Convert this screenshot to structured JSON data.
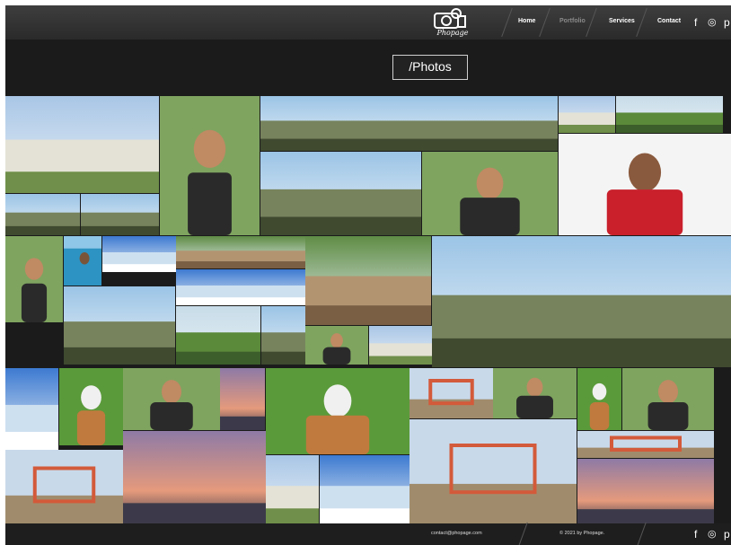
{
  "header": {
    "logo_text": "Phopage",
    "nav": [
      "Home",
      "Portfolio",
      "Services",
      "Contact"
    ]
  },
  "social": {
    "icons": [
      "facebook-icon",
      "instagram-icon",
      "pinterest-icon"
    ],
    "glyphs": [
      "f",
      "◎",
      "p"
    ]
  },
  "page_title": "/Photos",
  "footer": {
    "email": "contact@phopage.com",
    "copyright": "© 2021 by Phopage."
  },
  "photos": [
    {
      "name": "photo-apartment-complex",
      "scene": "building"
    },
    {
      "name": "photo-boxer-man",
      "scene": "portrait"
    },
    {
      "name": "photo-aerial-highway-panorama",
      "scene": "aerial"
    },
    {
      "name": "photo-apartment-building-small",
      "scene": "building"
    },
    {
      "name": "photo-aerial-curved-road",
      "scene": "aerial-green"
    },
    {
      "name": "photo-aerial-intersection",
      "scene": "aerial"
    },
    {
      "name": "photo-man-sunglasses-field",
      "scene": "portrait"
    },
    {
      "name": "photo-girl-glasses",
      "scene": "girl"
    },
    {
      "name": "photo-aerial-lake-left",
      "scene": "aerial"
    },
    {
      "name": "photo-aerial-city-small",
      "scene": "aerial"
    },
    {
      "name": "photo-man-basketball-sitting",
      "scene": "portrait"
    },
    {
      "name": "photo-man-pool-edge",
      "scene": "pool"
    },
    {
      "name": "photo-blue-sky-clouds",
      "scene": "sky"
    },
    {
      "name": "photo-boardwalk-tropical",
      "scene": "boardwalk"
    },
    {
      "name": "photo-aerial-wide-town",
      "scene": "aerial"
    },
    {
      "name": "photo-sky-horizon",
      "scene": "sky"
    },
    {
      "name": "photo-aerial-town-green",
      "scene": "aerial-green"
    },
    {
      "name": "photo-boardwalk-large",
      "scene": "boardwalk"
    },
    {
      "name": "photo-aerial-shopping-plaza",
      "scene": "aerial"
    },
    {
      "name": "photo-aerial-road-clouds",
      "scene": "aerial"
    },
    {
      "name": "photo-man-stairs",
      "scene": "portrait"
    },
    {
      "name": "photo-white-house",
      "scene": "building"
    },
    {
      "name": "photo-cloudy-sky",
      "scene": "sky"
    },
    {
      "name": "photo-bulldog-grass",
      "scene": "dog"
    },
    {
      "name": "photo-man-basketball-court",
      "scene": "portrait"
    },
    {
      "name": "photo-sunset-neighborhood",
      "scene": "sunset"
    },
    {
      "name": "photo-dog-grass-small",
      "scene": "dog"
    },
    {
      "name": "photo-playground-sculpture",
      "scene": "playground"
    },
    {
      "name": "photo-man-basketball-jump",
      "scene": "portrait"
    },
    {
      "name": "photo-bulldog-field",
      "scene": "dog"
    },
    {
      "name": "photo-man-beard-portrait",
      "scene": "portrait"
    },
    {
      "name": "photo-sunset-houses",
      "scene": "sunset"
    },
    {
      "name": "photo-park-playground",
      "scene": "playground"
    },
    {
      "name": "photo-playground-blue-roof",
      "scene": "playground"
    },
    {
      "name": "photo-swing-set",
      "scene": "playground"
    },
    {
      "name": "photo-resort-pool-building",
      "scene": "building"
    },
    {
      "name": "photo-man-sun-burst",
      "scene": "sky"
    },
    {
      "name": "photo-sunset-road",
      "scene": "sunset"
    },
    {
      "name": "photo-man-swimming-pool",
      "scene": "pool"
    }
  ]
}
